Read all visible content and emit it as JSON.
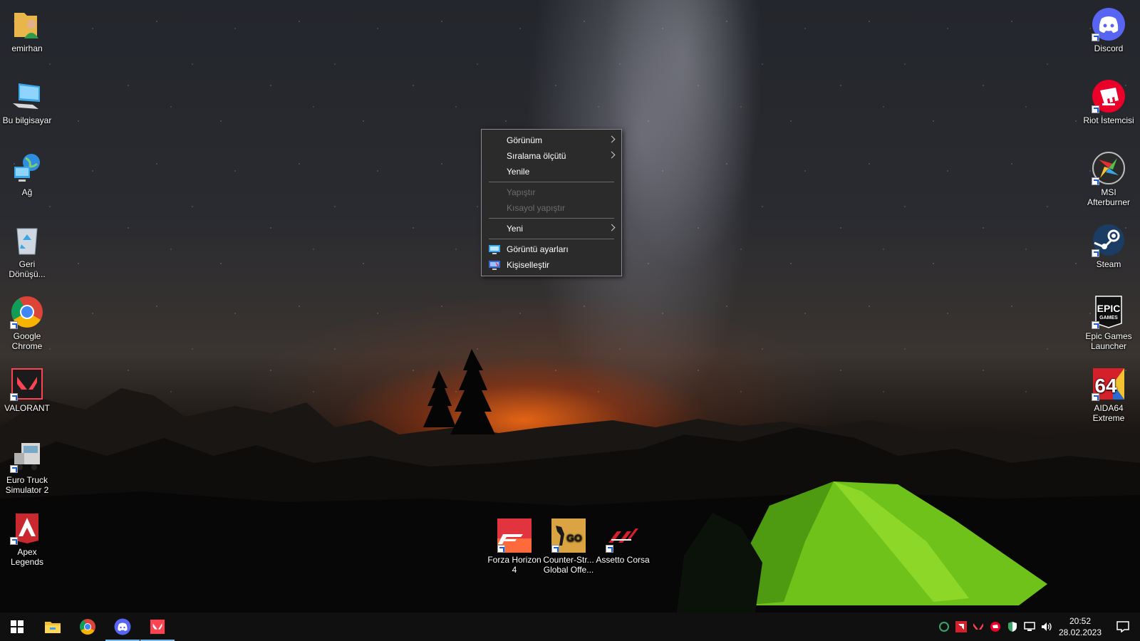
{
  "desktop": {
    "left_icons": [
      {
        "label": "emirhan",
        "icon": "user-folder-icon"
      },
      {
        "label": "Bu bilgisayar",
        "icon": "computer-icon"
      },
      {
        "label": "Ağ",
        "icon": "network-icon"
      },
      {
        "label": "Geri Dönüşü...",
        "icon": "recycle-bin-icon"
      },
      {
        "label": "Google Chrome",
        "icon": "chrome-icon"
      },
      {
        "label": "VALORANT",
        "icon": "valorant-icon"
      },
      {
        "label": "Euro Truck Simulator 2",
        "icon": "truck-icon"
      },
      {
        "label": "Apex Legends",
        "icon": "apex-icon"
      }
    ],
    "right_icons": [
      {
        "label": "Discord",
        "icon": "discord-icon"
      },
      {
        "label": "Riot İstemcisi",
        "icon": "riot-icon"
      },
      {
        "label": "MSI Afterburner",
        "icon": "msi-afterburner-icon"
      },
      {
        "label": "Steam",
        "icon": "steam-icon"
      },
      {
        "label": "Epic Games Launcher",
        "icon": "epic-games-icon"
      },
      {
        "label": "AIDA64 Extreme",
        "icon": "aida64-icon"
      }
    ],
    "bottom_icons": [
      {
        "label": "Forza Horizon 4",
        "icon": "forza-icon"
      },
      {
        "label": "Counter-Str... Global Offe...",
        "icon": "csgo-icon"
      },
      {
        "label": "Assetto Corsa",
        "icon": "assetto-corsa-icon"
      }
    ],
    "epic_text": "EPIC",
    "epic_sub": "GAMES",
    "aida_text": "64",
    "csgo_text": "GO"
  },
  "context_menu": {
    "items": [
      {
        "label": "Görünüm"
      },
      {
        "label": "Sıralama ölçütü"
      },
      {
        "label": "Yenile"
      },
      {
        "label": "Yapıştır"
      },
      {
        "label": "Kısayol yapıştır"
      },
      {
        "label": "Yeni"
      },
      {
        "label": "Görüntü ayarları"
      },
      {
        "label": "Kişiselleştir"
      }
    ]
  },
  "taskbar": {
    "clock_time": "20:52",
    "clock_date": "28.02.2023"
  },
  "colors": {
    "menu_bg": "#2b2b2b",
    "taskbar_bg": "#101010",
    "accent": "#76b9ed"
  }
}
